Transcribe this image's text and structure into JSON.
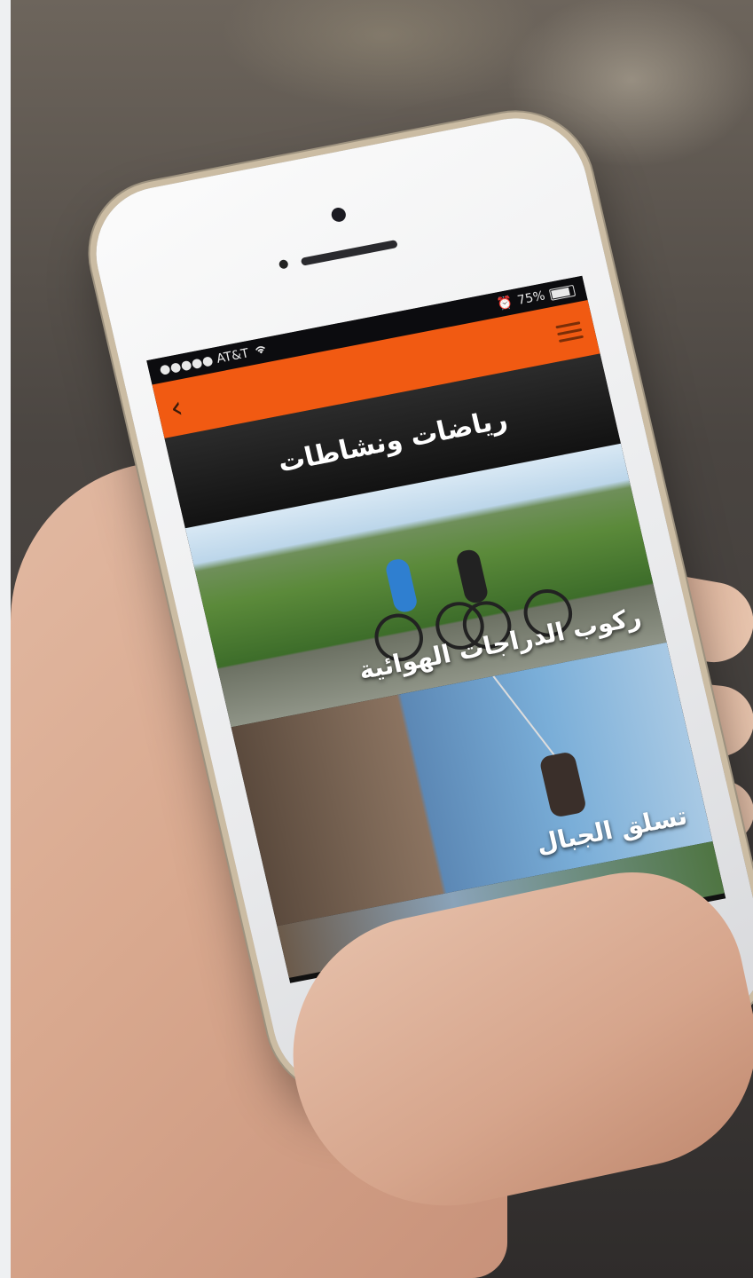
{
  "status_bar": {
    "carrier": "●●●●● AT&T",
    "battery": "75%"
  },
  "nav": {
    "back_icon": "chevron-left-icon",
    "menu_icon": "hamburger-icon",
    "accent_color": "#f15a12"
  },
  "page": {
    "title": "رياضات ونشاطات"
  },
  "activities": [
    {
      "label": "ركوب الدراجات الهوائية"
    },
    {
      "label": "تسلق الجبال"
    }
  ]
}
